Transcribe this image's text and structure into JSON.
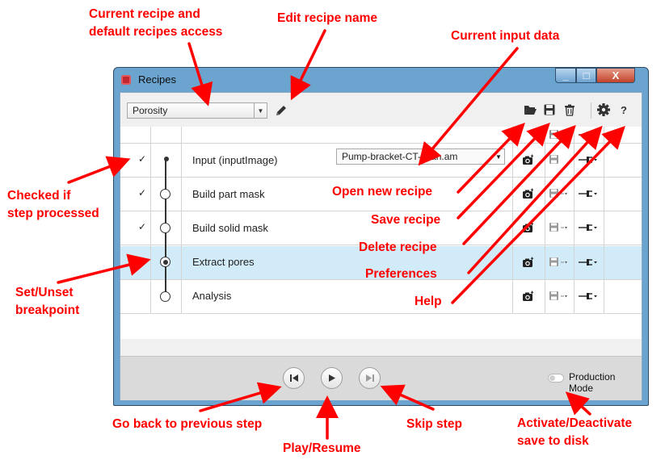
{
  "window": {
    "title": "Recipes",
    "recipe_selected": "Porosity",
    "input_selected": "Pump-bracket-CT-scan.am",
    "production_mode_label": "Production Mode",
    "titlebar_buttons": {
      "minimize": "_",
      "maximize": "□",
      "close": "X"
    }
  },
  "toolbar_icons": [
    "open-folder-icon",
    "save-icon",
    "trash-icon",
    "gear-icon",
    "help-icon"
  ],
  "steps": [
    {
      "label": "Input (inputImage)",
      "checked": true,
      "node": "dot"
    },
    {
      "label": "Build part mask",
      "checked": true,
      "node": "open"
    },
    {
      "label": "Build solid mask",
      "checked": true,
      "node": "open"
    },
    {
      "label": "Extract pores",
      "checked": false,
      "node": "breakpoint",
      "selected": true
    },
    {
      "label": "Analysis",
      "checked": false,
      "node": "open"
    }
  ],
  "annotations": {
    "current_recipe": [
      "Current recipe and",
      "default recipes access"
    ],
    "edit_name": "Edit recipe name",
    "current_input": "Current input data",
    "checked": [
      "Checked if",
      "step processed"
    ],
    "breakpoint": [
      "Set/Unset",
      "breakpoint"
    ],
    "open_recipe": "Open new recipe",
    "save_recipe": "Save recipe",
    "delete_recipe": "Delete recipe",
    "preferences": "Preferences",
    "help": "Help",
    "go_back": "Go back to previous step",
    "play": "Play/Resume",
    "skip": "Skip step",
    "activate": [
      "Activate/Deactivate",
      "save to disk"
    ]
  },
  "colors": {
    "annotation": "#ff0000",
    "selected_row": "#d1ecf8",
    "titlebar": "#6aa4cf"
  }
}
